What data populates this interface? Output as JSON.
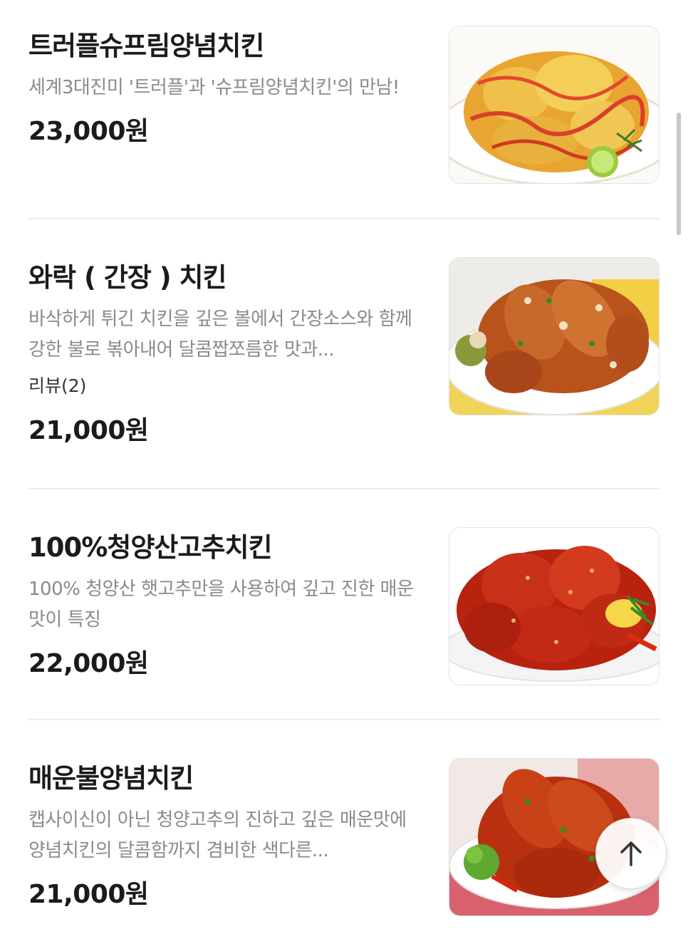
{
  "menu": {
    "items": [
      {
        "name": "트러플슈프림양념치킨",
        "description": "세계3대진미 '트러플'과 '슈프림양념치킨'의 만남!",
        "price": "23,000원",
        "image_icon": "truffle-supreme-chicken-photo"
      },
      {
        "name": "와락 ( 간장 ) 치킨",
        "description": "바삭하게 튀긴 치킨을 깊은 볼에서 간장소스와 함께 강한 불로 볶아내어 달콤짭쪼름한 맛과...",
        "review": "리뷰(2)",
        "price": "21,000원",
        "image_icon": "soy-garlic-chicken-photo"
      },
      {
        "name": "100%청양산고추치킨",
        "description": "100% 청양산 햇고추만을 사용하여 깊고 진한 매운맛이 특징",
        "price": "22,000원",
        "image_icon": "cheongyang-pepper-chicken-photo"
      },
      {
        "name": "매운불양념치킨",
        "description": "캡사이신이 아닌 청양고추의 진하고 깊은 매운맛에 양념치킨의 달콤함까지 겸비한 색다른...",
        "price": "21,000원",
        "image_icon": "spicy-fire-chicken-photo"
      }
    ]
  },
  "scroll_top_button": {
    "icon": "arrow-up-icon"
  },
  "colors": {
    "title": "#1b1b1b",
    "description": "#8a8a8a",
    "divider": "#ececec"
  }
}
